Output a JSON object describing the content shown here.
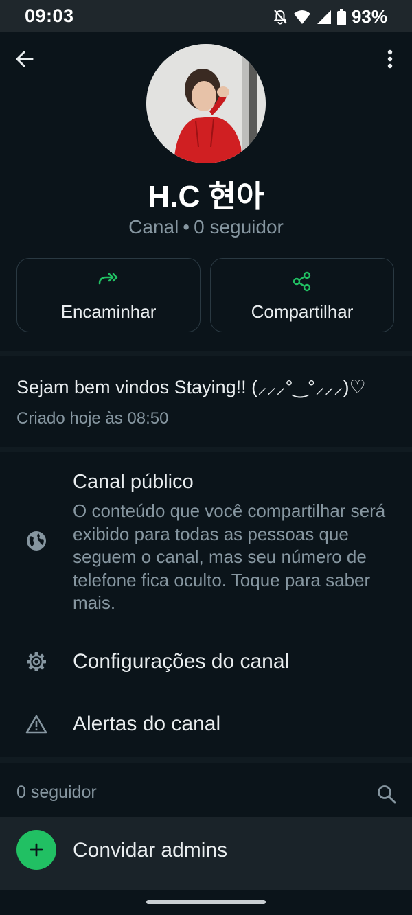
{
  "status_bar": {
    "time": "09:03",
    "battery": "93%",
    "icons": [
      "bell-off-icon",
      "wifi-icon",
      "signal-icon",
      "battery-icon"
    ]
  },
  "top_bar": {
    "back_icon": "arrow-left-icon",
    "menu_icon": "more-vertical-icon"
  },
  "channel": {
    "name": "H.C 현아",
    "type": "Canal",
    "separator": "•",
    "followers": "0 seguidor"
  },
  "actions": [
    {
      "label": "Encaminhar",
      "icon": "forward-icon"
    },
    {
      "label": "Compartilhar",
      "icon": "share-icon"
    }
  ],
  "description": {
    "text": "Sejam bem vindos Staying!! (⸝⸝⸝°‿°⸝⸝⸝)♡",
    "created": "Criado hoje às 08:50"
  },
  "public_channel": {
    "title": "Canal público",
    "body": "O conteúdo que você compartilhar será exibido para todas as pessoas que seguem o canal, mas seu número de telefone fica oculto. Toque para saber mais.",
    "icon": "globe-icon"
  },
  "settings_row": {
    "label": "Configurações do canal",
    "icon": "gear-icon"
  },
  "alerts_row": {
    "label": "Alertas do canal",
    "icon": "warning-icon"
  },
  "followers_section": {
    "count": "0 seguidor",
    "search_icon": "search-icon"
  },
  "invite_row": {
    "label": "Convidar admins",
    "icon": "plus-icon"
  },
  "colors": {
    "background": "#0b141a",
    "accent": "#21c063",
    "muted_text": "#8696a0",
    "status_bar": "#1f272c"
  }
}
